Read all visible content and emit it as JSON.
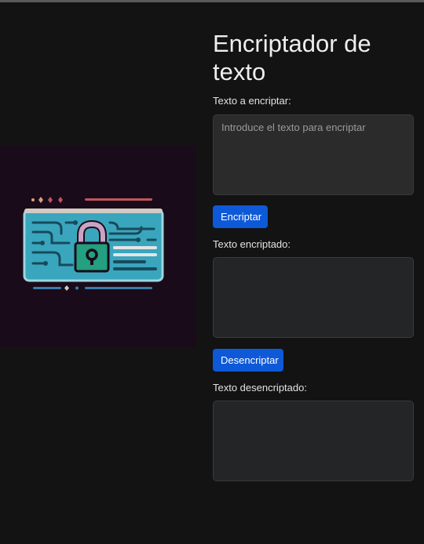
{
  "header": {
    "title": "Encriptador de texto"
  },
  "illustration": {
    "icon": "padlock-circuit-card",
    "colors": {
      "background": "#1a0b1a",
      "card_fill": "#3aa6bd",
      "lock": "#22a07f",
      "shackle": "#c9a3c3",
      "accent_red": "#c0545e"
    }
  },
  "encrypt_section": {
    "label": "Texto a encriptar:",
    "input_value": "",
    "input_placeholder": "Introduce el texto para encriptar",
    "button_label": "Encriptar"
  },
  "encrypted_section": {
    "label": "Texto encriptado:",
    "output_value": "",
    "button_label": "Desencriptar"
  },
  "decrypted_section": {
    "label": "Texto desencriptado:",
    "output_value": ""
  },
  "theme": {
    "page_bg": "#131313",
    "button_bg": "#0d59d8",
    "textbox_bg": "#2b2b2b"
  }
}
